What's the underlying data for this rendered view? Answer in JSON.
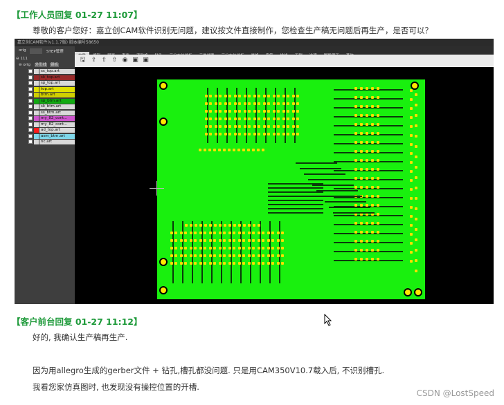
{
  "post1": {
    "header": "【工作人员回复 01-27 11:07】",
    "text": "尊敬的客户您好：嘉立创CAM软件识别无问题，建议按文件直接制作，您检查生产稿无问题后再生产，是否可以？"
  },
  "screenshot": {
    "title": "嘉立创CAM软件(v1.1.7版) 脚本编号58650",
    "left_tabs": [
      "orig",
      "STEP管理"
    ],
    "tree_root": "111",
    "tree_sub": "orig",
    "tree_buttons": [
      "外形线",
      "钢板"
    ],
    "tabs": [
      "文件",
      "编辑",
      "层面",
      "查看",
      "清除格",
      "钻孔",
      "三分方位线板",
      "元件线路",
      "三分方位线板",
      "最终",
      "字符",
      "排线",
      "天剧",
      "选项",
      "脚版保正",
      "其他"
    ],
    "active_tab": "文件",
    "layers": [
      {
        "name": "ss_top.art",
        "color": "#d9d9d9"
      },
      {
        "name": "sk_top.art",
        "color": "#9a2a2a"
      },
      {
        "name": "sp_top.art",
        "color": "#d9d9d9"
      },
      {
        "name": "top.art",
        "color": "#e0e000"
      },
      {
        "name": "btm.art",
        "color": "#d0d000"
      },
      {
        "name": "sp_btm.art",
        "color": "#11aa11"
      },
      {
        "name": "sk_btm.art",
        "color": "#d9d9d9"
      },
      {
        "name": "ss_btm.art",
        "color": "#d9d9d9"
      },
      {
        "name": "my_82_cont...",
        "color": "#cc55cc"
      },
      {
        "name": "my_82_cont...",
        "color": "#d9d9d9"
      },
      {
        "name": "ad_top.art",
        "color": "#ff1a1a"
      },
      {
        "name": "asm_btm.art",
        "color": "#7fd7ea"
      },
      {
        "name": "nc.art",
        "color": "#d9d9d9"
      }
    ],
    "toolbar_icons": [
      "save-icon",
      "import-icon",
      "export-icon",
      "export2-icon",
      "view-icon",
      "image-icon",
      "image2-icon"
    ]
  },
  "post2": {
    "header": "【客户前台回复 01-27 11:12】",
    "line1": "好的, 我确认生产稿再生产.",
    "line2": "因为用allegro生成的gerber文件 + 钻孔,槽孔都没问题. 只是用CAM350V10.7载入后, 不识别槽孔.",
    "line3": "我看您家仿真图时, 也发现没有操控位置的开槽."
  },
  "watermark": "CSDN @LostSpeed",
  "colors": {
    "header_green": "#1e9a3a",
    "board_green": "#19f00e",
    "pad_yellow": "#ffe000"
  }
}
